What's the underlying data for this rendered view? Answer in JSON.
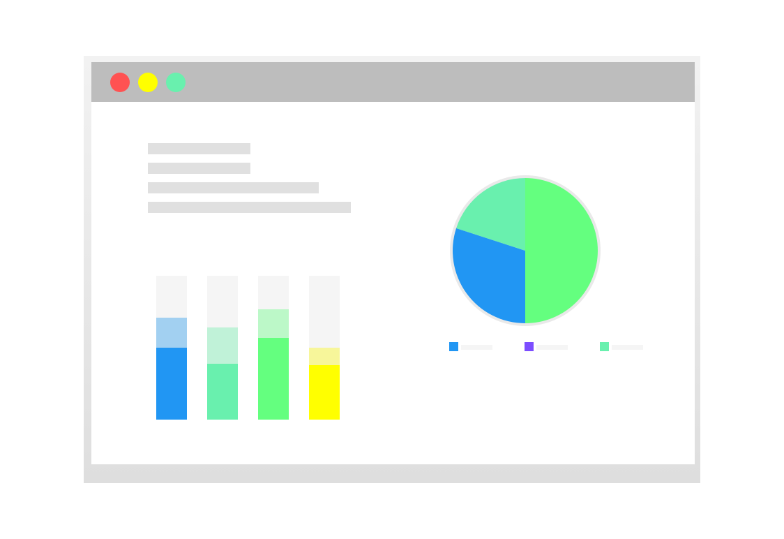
{
  "window": {
    "controls": [
      {
        "name": "close",
        "color": "#ff5252"
      },
      {
        "name": "minimize",
        "color": "#ffff00"
      },
      {
        "name": "maximize",
        "color": "#69f0ae"
      }
    ]
  },
  "colors": {
    "frame": "#efefef",
    "title_bar": "#bdbdbd",
    "placeholder": "#e0e0e0",
    "bar_track": "#f5f5f5"
  },
  "chart_data": [
    {
      "type": "bar",
      "stacked": true,
      "categories": [
        "",
        "",
        "",
        ""
      ],
      "ylim": [
        0,
        100
      ],
      "series": [
        {
          "values": [
            50,
            39,
            57,
            38
          ],
          "colors": [
            "#2196f3",
            "#69f0ae",
            "#64ff7f",
            "#ffff00"
          ]
        },
        {
          "values": [
            21,
            25,
            20,
            12
          ],
          "colors": [
            "#a2d0f1",
            "#c0f2d8",
            "#bcf8c8",
            "#f7f69a"
          ]
        }
      ]
    },
    {
      "type": "pie",
      "values": [
        50,
        30,
        20
      ],
      "colors": [
        "#64ff7f",
        "#2196f3",
        "#69f0ae"
      ],
      "legend": [
        {
          "color": "#2196f3",
          "label": ""
        },
        {
          "color": "#7c4dff",
          "label": ""
        },
        {
          "color": "#69f0ae",
          "label": ""
        }
      ],
      "legend_position": "bottom"
    }
  ]
}
